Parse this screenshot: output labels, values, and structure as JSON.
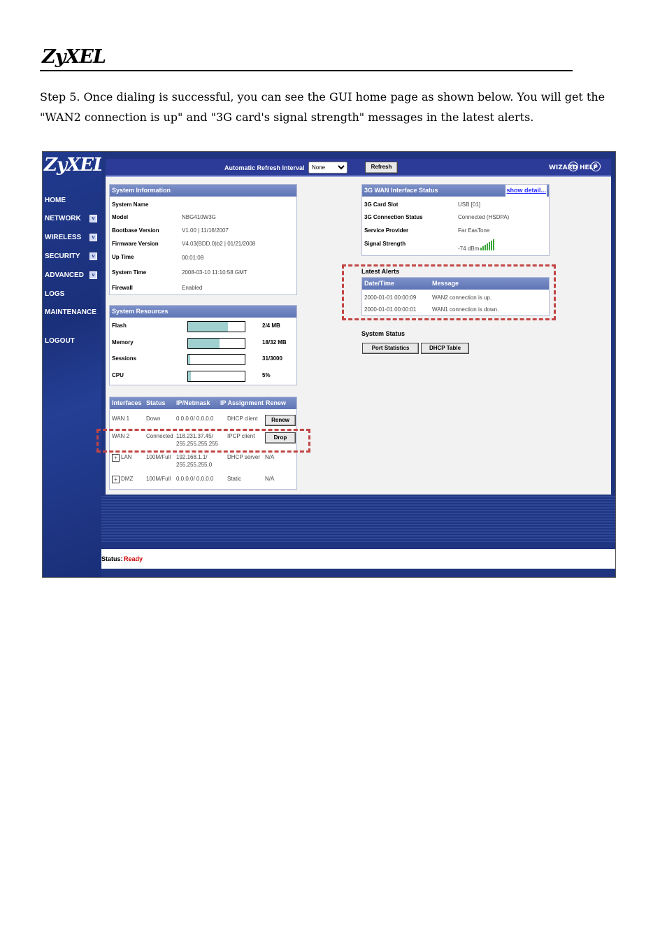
{
  "doc": {
    "logo": "ZyXEL",
    "paragraph": "Step 5. Once dialing is successful, you can see the GUI home page as shown below. You will get the \"WAN2 connection is up\" and \"3G card's signal strength\" messages in the latest alerts."
  },
  "gui": {
    "logo": "ZyXEL",
    "nav": [
      {
        "label": "HOME",
        "expand": false
      },
      {
        "label": "NETWORK",
        "expand": true
      },
      {
        "label": "WIRELESS",
        "expand": true
      },
      {
        "label": "SECURITY",
        "expand": true
      },
      {
        "label": "ADVANCED",
        "expand": true
      },
      {
        "label": "LOGS",
        "expand": false
      },
      {
        "label": "MAINTENANCE",
        "expand": false
      },
      {
        "label": "LOGOUT",
        "expand": false
      }
    ],
    "topbar": {
      "refresh_interval_label": "Automatic Refresh Interval",
      "refresh_interval_value": "None",
      "refresh_button": "Refresh",
      "wizard": "WIZARD",
      "help": "HELP"
    },
    "system_info": {
      "title": "System Information",
      "rows": [
        {
          "k": "System Name",
          "v": ""
        },
        {
          "k": "Model",
          "v": "NBG410W3G"
        },
        {
          "k": "Bootbase Version",
          "v": "V1.00 | 11/16/2007"
        },
        {
          "k": "Firmware Version",
          "v": "V4.03(BDD.0)b2 | 01/21/2008"
        },
        {
          "k": "Up Time",
          "v": "00:01:08"
        },
        {
          "k": "System Time",
          "v": "2008-03-10 11:10:58 GMT"
        },
        {
          "k": "Firewall",
          "v": "Enabled"
        }
      ]
    },
    "system_resources": {
      "title": "System Resources",
      "rows": [
        {
          "k": "Flash",
          "v": "2/4 MB",
          "fraction": 0.7
        },
        {
          "k": "Memory",
          "v": "18/32 MB",
          "fraction": 0.56
        },
        {
          "k": "Sessions",
          "v": "31/3000",
          "fraction": 0.04
        },
        {
          "k": "CPU",
          "v": "5%",
          "fraction": 0.05
        }
      ]
    },
    "interfaces": {
      "headers": [
        "Interfaces",
        "Status",
        "IP/Netmask",
        "IP Assignment",
        "Renew"
      ],
      "rows": [
        {
          "name": "WAN 1",
          "status": "Down",
          "ip": "0.0.0.0/ 0.0.0.0",
          "assign": "DHCP client",
          "action": "Renew"
        },
        {
          "name": "WAN 2",
          "status": "Connected",
          "ip": "118.231.37.45/",
          "ip2": "255.255.255.255",
          "assign": "IPCP client",
          "action": "Drop"
        },
        {
          "name": "LAN",
          "status": "100M/Full",
          "ip": "192.168.1.1/",
          "ip2": "255.255.255.0",
          "assign": "DHCP server",
          "action": "N/A"
        },
        {
          "name": "DMZ",
          "status": "100M/Full",
          "ip": "0.0.0.0/ 0.0.0.0",
          "assign": "Static",
          "action": "N/A"
        }
      ]
    },
    "wan3g": {
      "title": "3G WAN Interface Status",
      "show_detail": "show detail...",
      "rows": [
        {
          "k": "3G Card Slot",
          "v": "USB [01]"
        },
        {
          "k": "3G Connection Status",
          "v": "Connected (HSDPA)"
        },
        {
          "k": "Service Provider",
          "v": "Far EasTone"
        },
        {
          "k": "Signal Strength",
          "v": "-74 dBm"
        }
      ]
    },
    "alerts": {
      "title": "Latest Alerts",
      "headers": [
        "Date/Time",
        "Message"
      ],
      "rows": [
        {
          "time": "2000-01-01 00:00:09",
          "msg": "WAN2 connection is up."
        },
        {
          "time": "2000-01-01 00:00:01",
          "msg": "WAN1 connection is down."
        }
      ]
    },
    "system_status": {
      "title": "System Status",
      "buttons": [
        "Port Statistics",
        "DHCP Table"
      ]
    },
    "status": {
      "label": "Status:",
      "value": "Ready"
    }
  }
}
